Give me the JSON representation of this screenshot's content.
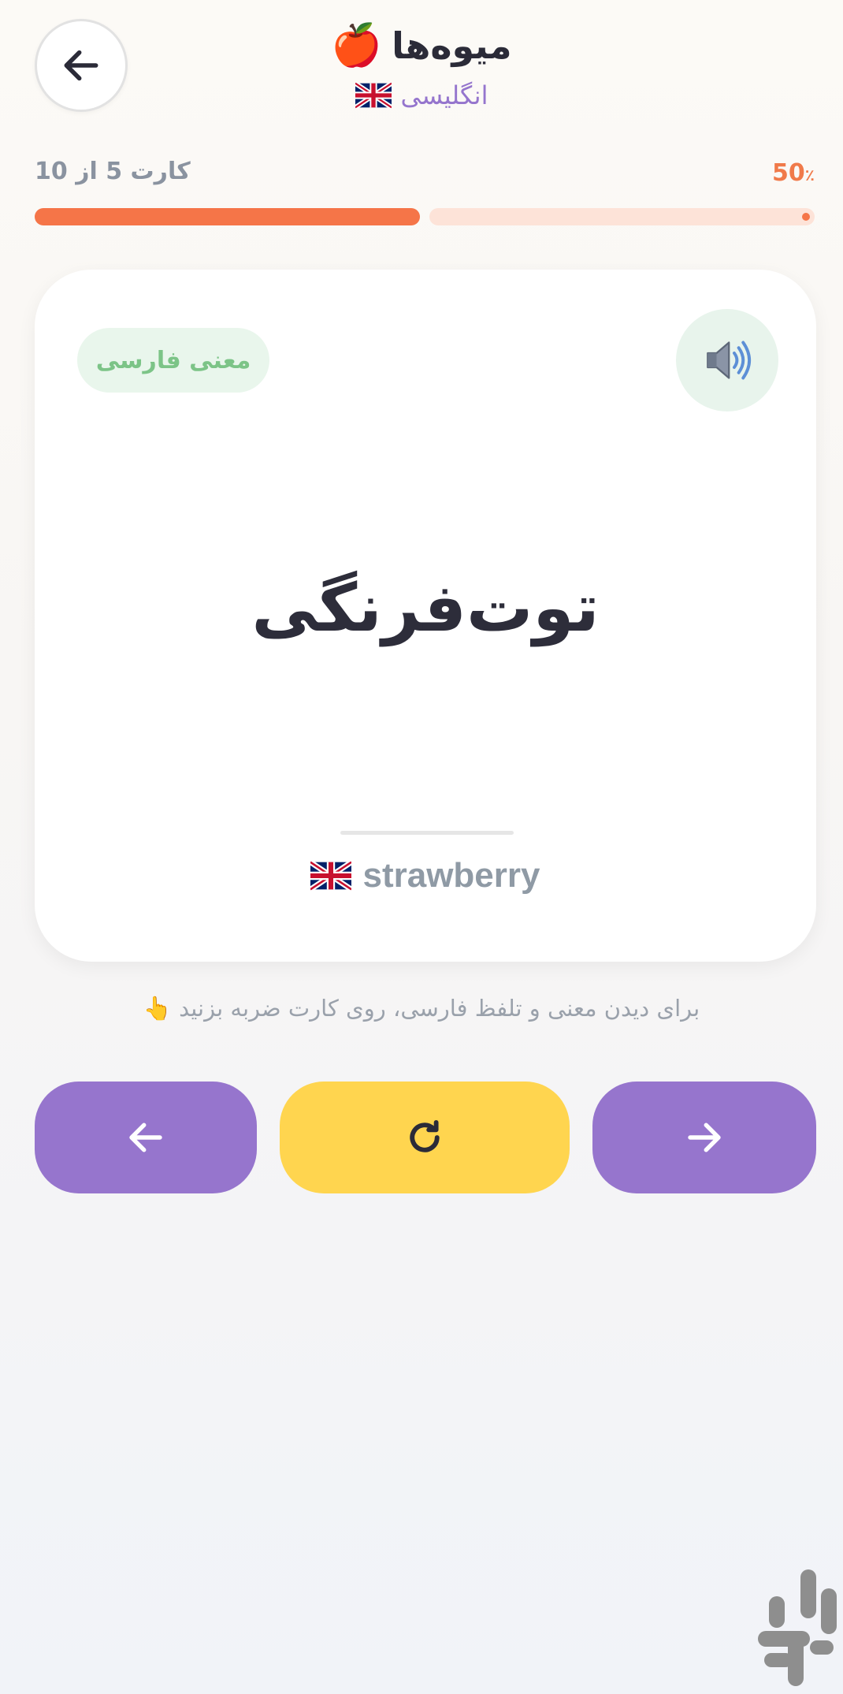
{
  "header": {
    "title": "میوه‌ها",
    "title_emoji": "🍎",
    "subtitle": "انگلیسی",
    "back_icon": "arrow-left-icon"
  },
  "progress": {
    "count_label": "کارت 5 از 10",
    "percent": "50",
    "percent_sign": "٪",
    "fraction": 0.5,
    "fill_color": "#f57548",
    "track_color": "#fde3d8"
  },
  "card": {
    "badge_label": "معنی فارسی",
    "speaker_icon": "speaker-icon",
    "word_fa": "توت‌فرنگی",
    "word_en": "strawberry",
    "flag_icon": "uk-flag-icon"
  },
  "hint": {
    "text": "برای دیدن معنی و تلفظ فارسی، روی کارت ضربه بزنید",
    "emoji": "👆"
  },
  "controls": {
    "prev_icon": "arrow-left-icon",
    "reset_icon": "refresh-icon",
    "next_icon": "arrow-right-icon",
    "purple": "#9675cd",
    "yellow": "#ffd54f"
  },
  "store": {
    "logo_icon": "bazaar-logo-icon"
  }
}
